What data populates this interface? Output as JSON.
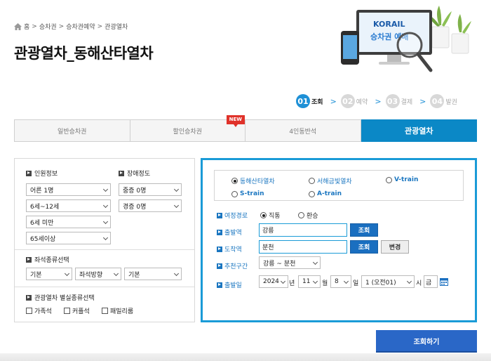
{
  "breadcrumb": {
    "items": [
      "홈",
      "승차권",
      "승차권예약",
      "관광열차"
    ],
    "sep": ">"
  },
  "page_title": "관광열차_동해산타열차",
  "hero": {
    "logo": "KORAIL",
    "caption": "승차권 예매"
  },
  "steps": [
    {
      "num": "01",
      "label": "조회",
      "active": true
    },
    {
      "num": "02",
      "label": "예약",
      "active": false
    },
    {
      "num": "03",
      "label": "결제",
      "active": false
    },
    {
      "num": "04",
      "label": "발권",
      "active": false
    }
  ],
  "step_arrow": ">",
  "tabs": [
    {
      "label": "일반승차권",
      "active": false
    },
    {
      "label": "할인승차권",
      "active": false,
      "badge": "NEW"
    },
    {
      "label": "4인동반석",
      "active": false
    },
    {
      "label": "관광열차",
      "active": true
    }
  ],
  "passengers": {
    "label": "인원정보",
    "adult": "어른 1명",
    "child": "6세~12세",
    "toddler": "6세 미만",
    "senior": "65세이상"
  },
  "disability": {
    "label": "장애정도",
    "severe": "중증 0명",
    "mild": "경증 0명"
  },
  "seat_type": {
    "label": "좌석종류선택",
    "type": "기본",
    "direction": "좌석방향",
    "position": "기본"
  },
  "special_seat": {
    "label": "관광열차 별실종류선택",
    "options": [
      "가족석",
      "커플석",
      "패밀리룸"
    ]
  },
  "trains": [
    {
      "label": "동해산타열차",
      "selected": true,
      "bold": false
    },
    {
      "label": "서해금빛열차",
      "selected": false,
      "bold": false
    },
    {
      "label": "V-train",
      "selected": false,
      "bold": true
    },
    {
      "label": "S-train",
      "selected": false,
      "bold": true
    },
    {
      "label": "A-train",
      "selected": false,
      "bold": true
    }
  ],
  "route": {
    "label": "여정경로",
    "direct": "직통",
    "round": "환승",
    "selected": "직통"
  },
  "departure": {
    "label": "출발역",
    "value": "강릉",
    "search_label": "조회"
  },
  "arrival": {
    "label": "도착역",
    "value": "분천",
    "search_label": "조회",
    "change_label": "변경"
  },
  "recommend": {
    "label": "추천구간",
    "value": "강릉 ~ 분천"
  },
  "date": {
    "label": "출발일",
    "year": "2024",
    "year_unit": "년",
    "month": "11",
    "month_unit": "월",
    "day": "8",
    "day_unit": "일",
    "hour": "1 (오전01)",
    "hour_unit": "시",
    "weekday": "금"
  },
  "submit_label": "조회하기",
  "colors": {
    "accent": "#0b88c6",
    "panel_border": "#1a9bd7",
    "button": "#2a67c7",
    "badge": "#e0322a"
  }
}
